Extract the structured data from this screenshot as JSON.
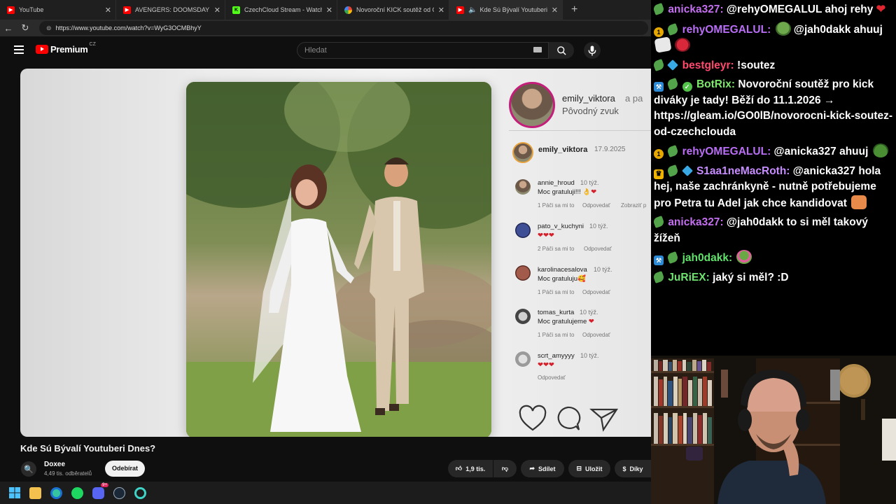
{
  "browser": {
    "tabs": [
      {
        "label": "YouTube",
        "fav_color": "#ff0000"
      },
      {
        "label": "AVENGERS: DOOMSDAY mě začíná",
        "fav_color": "#ff0000"
      },
      {
        "label": "CzechCloud Stream - Watch Live o",
        "fav_color": "#53fc18"
      },
      {
        "label": "Novoroční KICK soutěž od CzechC",
        "fav_color": "#4285f4"
      },
      {
        "label": "Kde Sú Bývalí Youtuberi Dnes?",
        "fav_color": "#ff0000"
      }
    ],
    "url": "https://www.youtube.com/watch?v=WyG3OCMBhyY"
  },
  "youtube": {
    "logo_text": "Premium",
    "country": "CZ",
    "search_placeholder": "Hledat",
    "video_title": "Kde Sú Bývalí Youtuberi Dnes?",
    "channel_name": "Doxee",
    "subscribers": "4,49 tis. odběratelů",
    "subscribe_label": "Odebírat",
    "likes": "1,9 tis.",
    "share_label": "Sdílet",
    "save_label": "Uložit",
    "thanks_label": "Díky"
  },
  "instagram": {
    "header_user": "emily_viktora",
    "header_extra": "a pa",
    "header_audio": "Pôvodný zvuk",
    "post_user": "emily_viktora",
    "post_date": "17.9.2025",
    "comments": [
      {
        "user": "annie_hroud",
        "time": "10 týž.",
        "text": "Moc gratuluji!!!",
        "emoji": "👌❤",
        "meta": "1 Páči sa mi to",
        "reply": "Odpovedať",
        "extra": "Zobraziť p"
      },
      {
        "user": "pato_v_kuchyni",
        "time": "10 týž.",
        "text": "",
        "emoji": "❤❤❤",
        "meta": "2 Páči sa mi to",
        "reply": "Odpovedať",
        "extra": ""
      },
      {
        "user": "karolinacesalova",
        "time": "10 týž.",
        "text": "Moc gratuluju",
        "emoji": "🥰",
        "meta": "1 Páči sa mi to",
        "reply": "Odpovedať",
        "extra": ""
      },
      {
        "user": "tomas_kurta",
        "time": "10 týž.",
        "text": "Moc gratulujeme",
        "emoji": "❤",
        "meta": "1 Páči sa mi to",
        "reply": "Odpovedať",
        "extra": ""
      },
      {
        "user": "scrt_amyyyy",
        "time": "10 týž.",
        "text": "",
        "emoji": "❤❤❤",
        "meta": "",
        "reply": "Odpovedať",
        "extra": ""
      }
    ]
  },
  "chat": {
    "messages": [
      {
        "badges": [
          "leaf"
        ],
        "user": "anicka327",
        "color": "#c36ff0",
        "text": "@rehyOMEGALUL ahoj rehy",
        "emotes_after": [
          "heart"
        ]
      },
      {
        "badges": [
          "coin",
          "leaf"
        ],
        "user": "rehyOMEGALUL",
        "color": "#b96ef5",
        "text": "@jah0dakk ahuuj",
        "emotes_before": [
          "frog"
        ],
        "emotes_after": [
          "paper",
          "berry"
        ]
      },
      {
        "badges": [
          "leaf",
          "cube"
        ],
        "user": "bestgleyr",
        "color": "#ff4a6e",
        "text": "!soutez"
      },
      {
        "badges": [
          "bot",
          "leaf",
          "verif"
        ],
        "user": "BotRix",
        "color": "#7de86b",
        "text": "Novoroční soutěž pro kick diváky je tady! Běží do 11.1.2026 → https://gleam.io/GO0lB/novorocni-kick-soutez-od-czechclouda"
      },
      {
        "badges": [
          "coin",
          "leaf"
        ],
        "user": "rehyOMEGALUL",
        "color": "#b96ef5",
        "text": "@anicka327 ahuuj",
        "emotes_after": [
          "pepe"
        ]
      },
      {
        "badges": [
          "crown",
          "leaf",
          "cube"
        ],
        "user": "S1aa1neMacRoth",
        "color": "#c78cff",
        "text": "@anicka327 hola hej, naše zachránkyně - nutně potřebujeme pro Petra tu Adel jak chce kandidovat",
        "emotes_mid": [
          "frog"
        ],
        "emotes_after": [
          "face"
        ]
      },
      {
        "badges": [
          "leaf"
        ],
        "user": "anicka327",
        "color": "#c36ff0",
        "text": "@jah0dakk to si měl takový žížeň"
      },
      {
        "badges": [
          "bot",
          "leaf"
        ],
        "user": "jah0dakk",
        "color": "#5fe36a",
        "text": "",
        "emotes_after": [
          "bow"
        ]
      },
      {
        "badges": [
          "leaf"
        ],
        "user": "JuRiEX",
        "color": "#6fe36f",
        "text": "jaký si měl? :D"
      }
    ]
  },
  "taskbar": {
    "icons": [
      "windows-icon",
      "file-explorer-icon",
      "edge-icon",
      "spotify-icon",
      "discord-icon",
      "steam-icon",
      "app-icon"
    ],
    "discord_badge": "9+"
  }
}
